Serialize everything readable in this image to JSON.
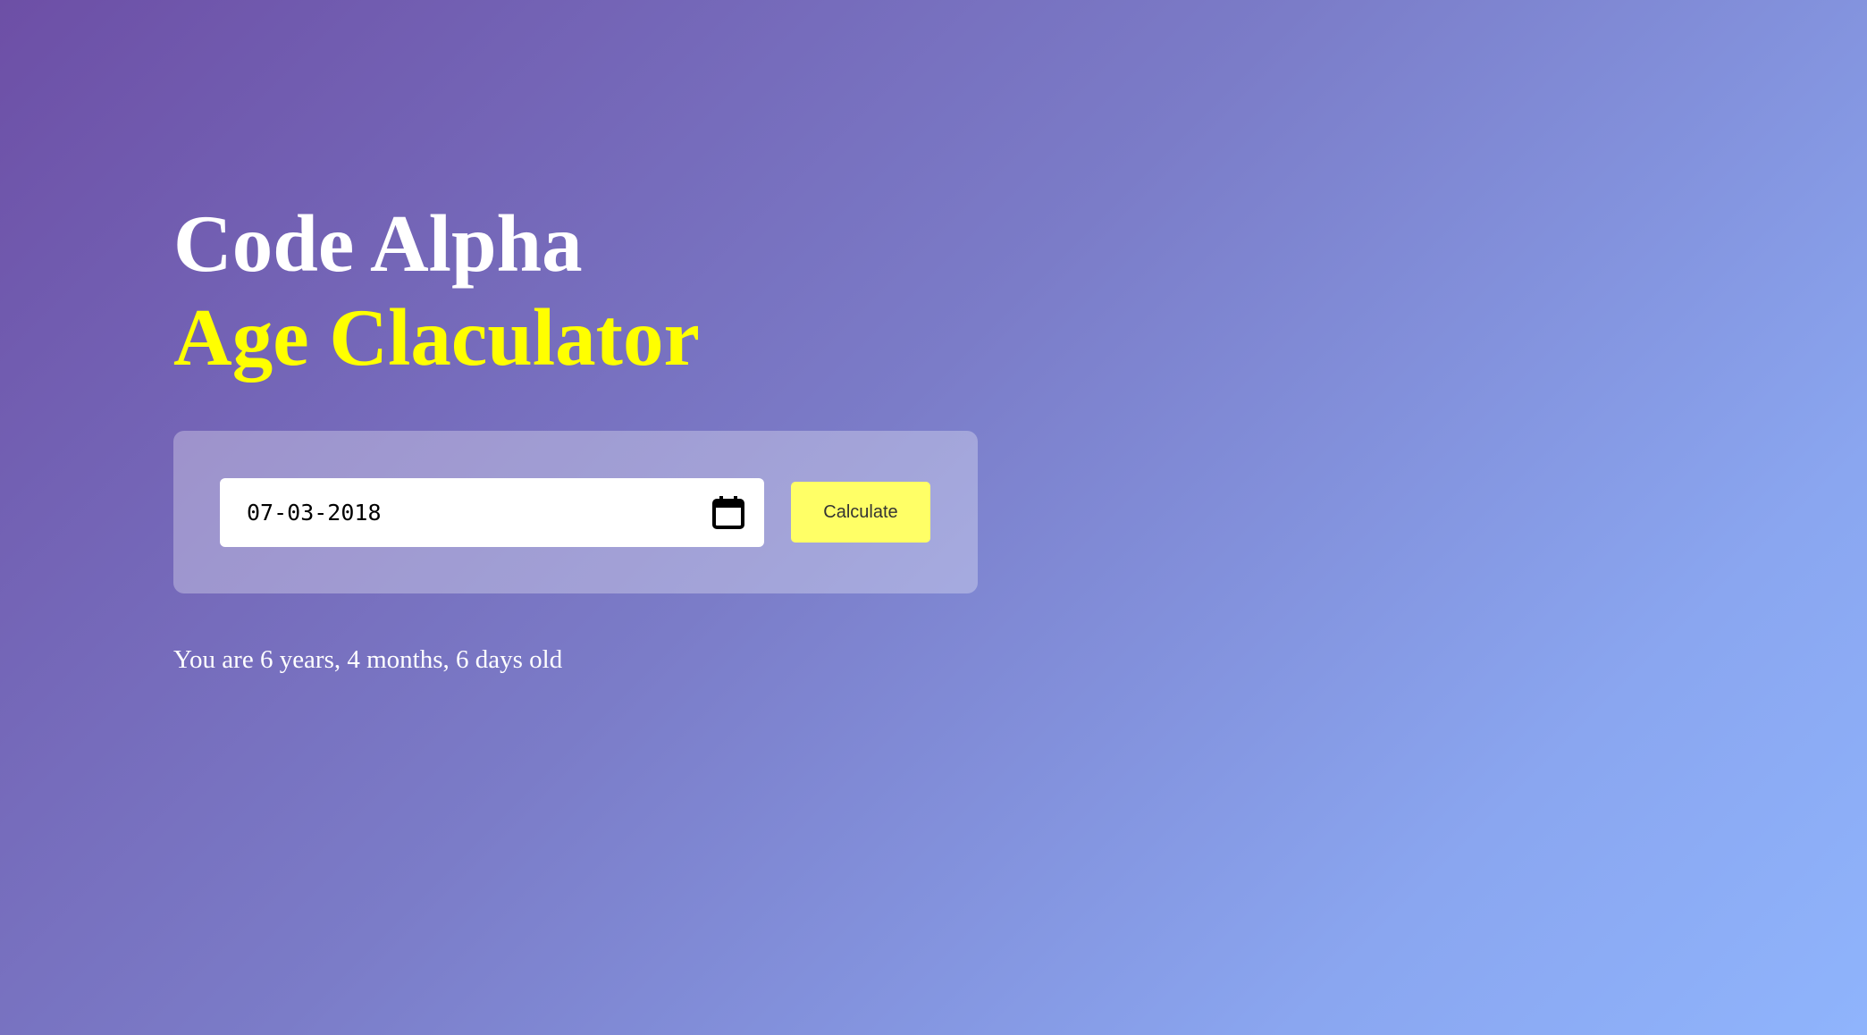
{
  "header": {
    "title": "Code Alpha",
    "subtitle": "Age Claculator"
  },
  "form": {
    "date_value": "07-03-2018",
    "calculate_label": "Calculate"
  },
  "result": {
    "text": "You are 6 years, 4 months, 6 days old"
  },
  "icons": {
    "calendar": "calendar-icon"
  },
  "colors": {
    "title": "#ffffff",
    "subtitle": "#ffff00",
    "button": "#ffff66",
    "gradient_start": "#6d4fa6",
    "gradient_end": "#8fb4fc"
  }
}
